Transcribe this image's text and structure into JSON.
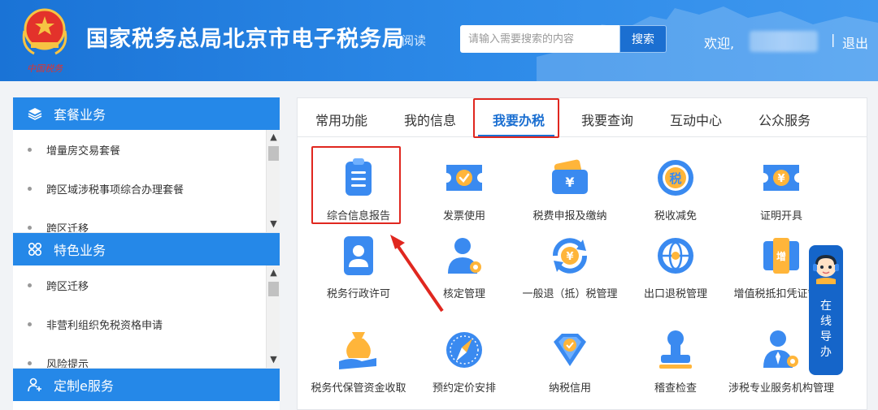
{
  "header": {
    "site_title": "国家税务总局北京市电子税务局",
    "read_link": "阅读",
    "search_placeholder": "请输入需要搜索的内容",
    "search_button": "搜索",
    "welcome": "欢迎,",
    "separator": "|",
    "logout": "退出",
    "emblem_text": "中国税务"
  },
  "sidebar": {
    "sections": [
      {
        "title": "套餐业务",
        "icon": "layers-icon",
        "items": [
          "增量房交易套餐",
          "跨区域涉税事项综合办理套餐",
          "跨区迁移"
        ]
      },
      {
        "title": "特色业务",
        "icon": "grid-icon",
        "items": [
          "跨区迁移",
          "非营利组织免税资格申请",
          "风险提示"
        ]
      },
      {
        "title": "定制e服务",
        "icon": "user-plus-icon",
        "items": []
      }
    ]
  },
  "tabs": [
    {
      "label": "常用功能"
    },
    {
      "label": "我的信息"
    },
    {
      "label": "我要办税",
      "active": true
    },
    {
      "label": "我要查询"
    },
    {
      "label": "互动中心"
    },
    {
      "label": "公众服务"
    }
  ],
  "grid": [
    {
      "label": "综合信息报告",
      "icon": "clipboard-icon"
    },
    {
      "label": "发票使用",
      "icon": "invoice-check-icon"
    },
    {
      "label": "税费申报及缴纳",
      "icon": "yuan-card-icon"
    },
    {
      "label": "税收减免",
      "icon": "tax-relief-icon"
    },
    {
      "label": "证明开具",
      "icon": "yuan-ticket-icon"
    },
    {
      "label": "税务行政许可",
      "icon": "id-badge-icon"
    },
    {
      "label": "核定管理",
      "icon": "user-gear-icon"
    },
    {
      "label": "一般退（抵）税管理",
      "icon": "yuan-refresh-icon"
    },
    {
      "label": "出口退税管理",
      "icon": "globe-icon"
    },
    {
      "label": "增值税抵扣凭证管理",
      "icon": "vat-doc-icon"
    },
    {
      "label": "税务代保管资金收取",
      "icon": "money-bag-icon"
    },
    {
      "label": "预约定价安排",
      "icon": "compass-icon"
    },
    {
      "label": "纳税信用",
      "icon": "diamond-check-icon"
    },
    {
      "label": "稽查检查",
      "icon": "stamp-icon"
    },
    {
      "label": "涉税专业服务机构管理",
      "icon": "user-tie-gear-icon"
    }
  ],
  "float_help": {
    "text": "在线导办",
    "icon": "headset-avatar-icon"
  },
  "colors": {
    "brand": "#1b6fd1",
    "header": "#2588e8",
    "highlight": "#e0271f"
  }
}
